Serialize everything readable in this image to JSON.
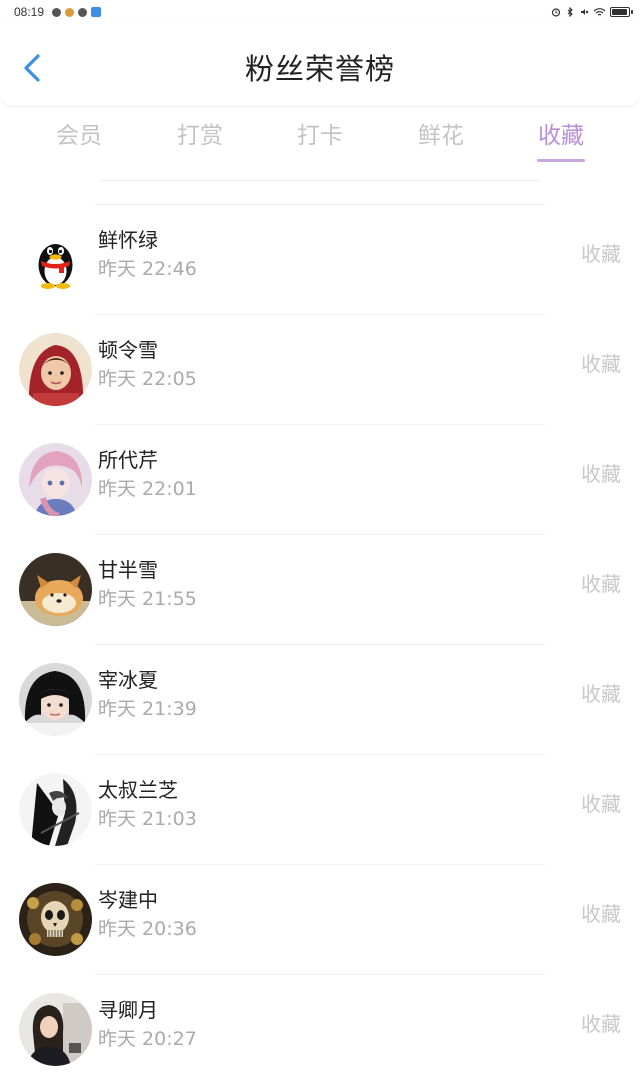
{
  "status_bar": {
    "time": "08:19"
  },
  "header": {
    "title": "粉丝荣誉榜",
    "back_icon": "chevron-left-icon",
    "accent_color": "#3a8ee6"
  },
  "tabs": [
    {
      "label": "会员",
      "active": false
    },
    {
      "label": "打赏",
      "active": false
    },
    {
      "label": "打卡",
      "active": false
    },
    {
      "label": "鲜花",
      "active": false
    },
    {
      "label": "收藏",
      "active": true
    }
  ],
  "active_tab_color": "#b98fd6",
  "fans": [
    {
      "name": "鲜怀绿",
      "time": "昨天 22:46",
      "action": "收藏",
      "avatar": "qq-penguin-avatar"
    },
    {
      "name": "顿令雪",
      "time": "昨天 22:05",
      "action": "收藏",
      "avatar": "girl-red-hood-avatar"
    },
    {
      "name": "所代芹",
      "time": "昨天 22:01",
      "action": "收藏",
      "avatar": "anime-girl-avatar"
    },
    {
      "name": "甘半雪",
      "time": "昨天 21:55",
      "action": "收藏",
      "avatar": "puppy-avatar"
    },
    {
      "name": "宰冰夏",
      "time": "昨天 21:39",
      "action": "收藏",
      "avatar": "girl-black-hair-avatar"
    },
    {
      "name": "太叔兰芝",
      "time": "昨天 21:03",
      "action": "收藏",
      "avatar": "monochrome-figure-avatar"
    },
    {
      "name": "岑建中",
      "time": "昨天 20:36",
      "action": "收藏",
      "avatar": "skull-art-avatar"
    },
    {
      "name": "寻卿月",
      "time": "昨天 20:27",
      "action": "收藏",
      "avatar": "woman-photo-avatar"
    }
  ]
}
